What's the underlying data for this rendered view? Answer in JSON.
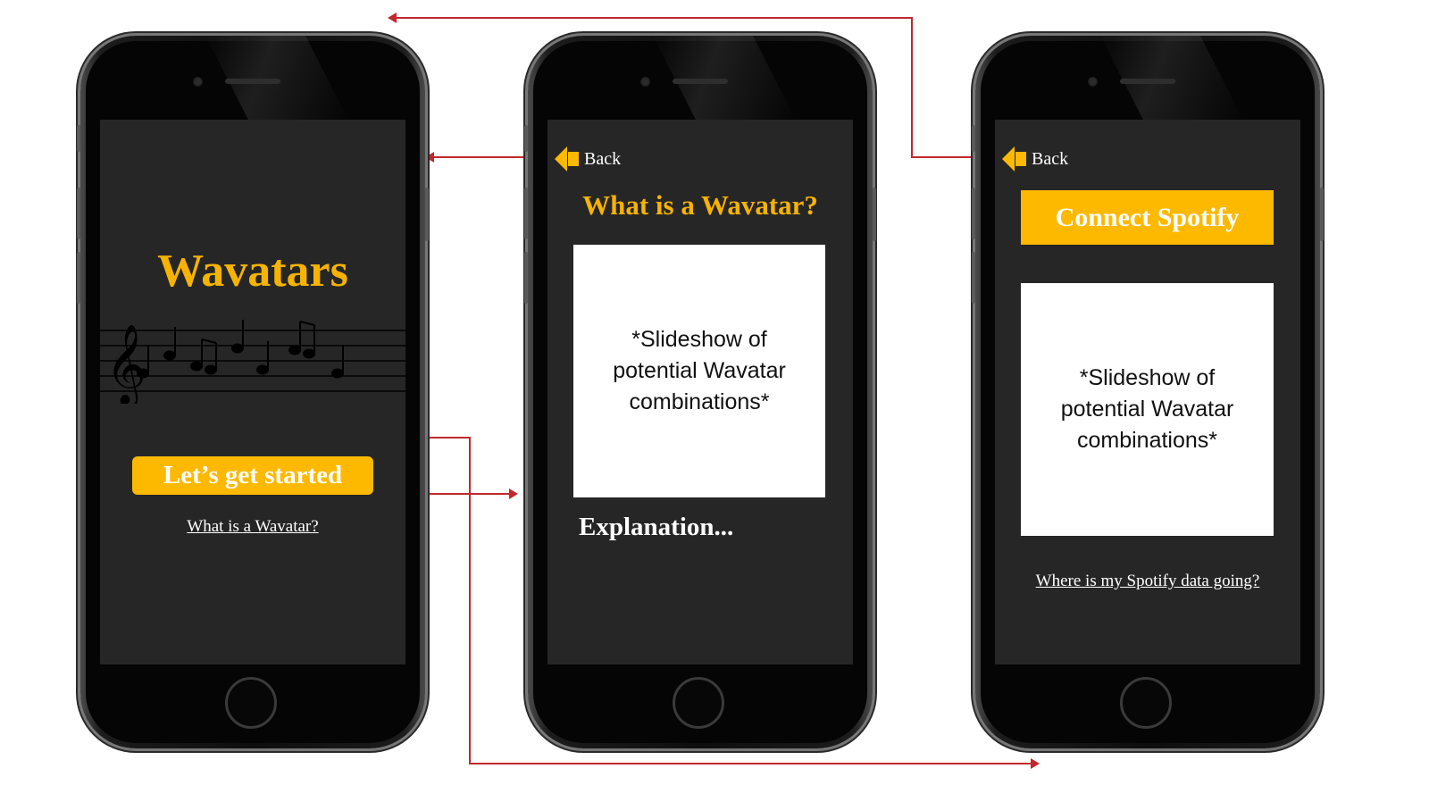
{
  "phone1": {
    "app_title": "Wavatars",
    "start_button": "Let’s get started",
    "what_link": "What is a Wavatar?"
  },
  "phone2": {
    "back_label": "Back",
    "heading": "What is a Wavatar?",
    "slideshow_text": "*Slideshow of potential Wavatar combinations*",
    "explanation": "Explanation..."
  },
  "phone3": {
    "back_label": "Back",
    "connect_button": "Connect Spotify",
    "slideshow_text": "*Slideshow of potential Wavatar combinations*",
    "data_link": "Where is my Spotify data going?"
  },
  "colors": {
    "accent": "#fcb900",
    "screen_bg": "#262626",
    "flow_arrow": "#c0282d"
  },
  "icons": [
    "back-arrow-icon",
    "music-staff-icon",
    "camera-icon",
    "home-button-icon"
  ]
}
